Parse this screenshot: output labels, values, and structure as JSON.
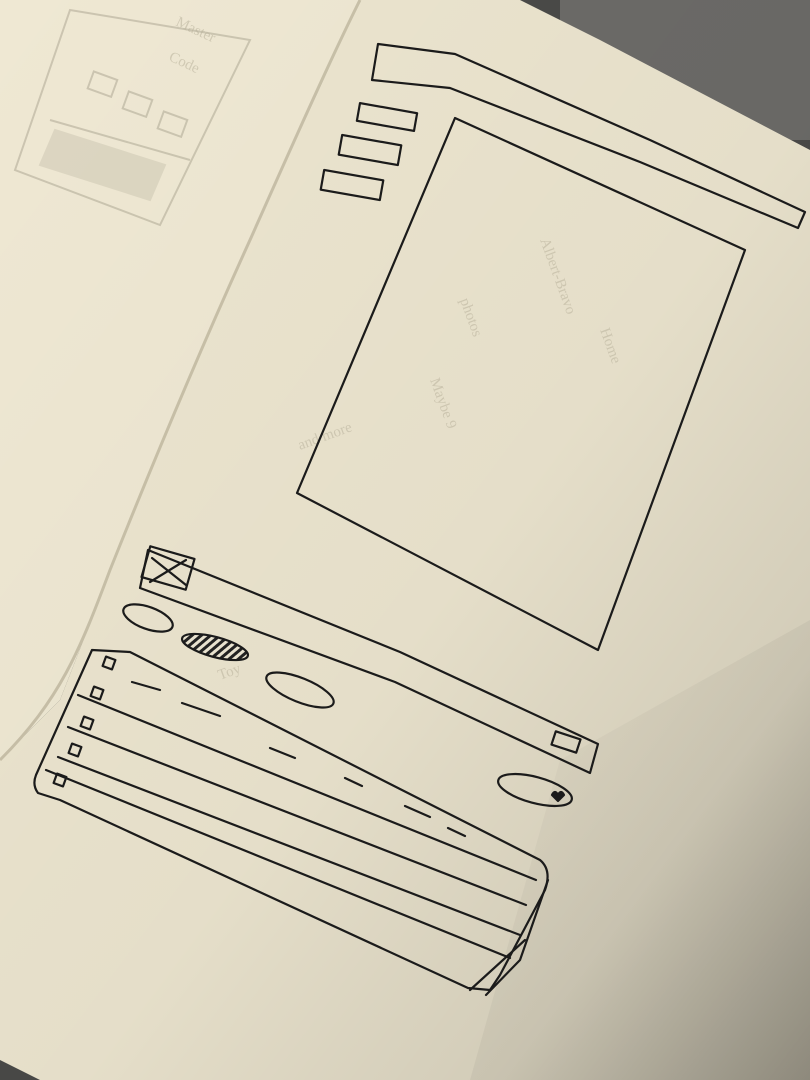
{
  "left_page": {
    "faint_words": [
      "Master",
      "Code"
    ]
  },
  "right_page": {
    "faint_words": [
      "Albert-Bravo",
      "photos",
      "Maybe 9",
      "Home",
      "and more",
      "Toy"
    ]
  },
  "sketch": {
    "header_bar": {
      "kind": "top-bar"
    },
    "side_nav": {
      "button_count": 3
    },
    "main_canvas": {
      "kind": "content-area"
    },
    "toolbar": {
      "close_box": "close-icon",
      "pills": 3,
      "striped_pill": "progress-bar",
      "right_button": "small-square-button"
    },
    "action_pill": {
      "icon": "heart-icon"
    },
    "list": {
      "rows": 5,
      "row_marker": "checkbox"
    }
  }
}
